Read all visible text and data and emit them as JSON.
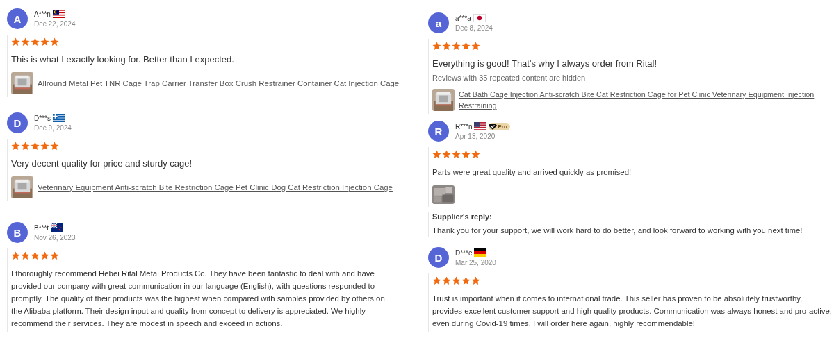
{
  "columns": [
    {
      "reviews": [
        {
          "initial": "A",
          "name": "A***n",
          "flag": {
            "kind": "my"
          },
          "date": "Dec 22, 2024",
          "stars": 5,
          "text": "This is what I exactly looking for. Better than I expected.",
          "product": {
            "kind": "picture",
            "title": "Allround Metal Pet TNR Cage Trap Carrier Transfer Box Crush Restrainer Container Cat Injection Cage"
          }
        },
        {
          "initial": "D",
          "name": "D***s",
          "flag": {
            "kind": "gr"
          },
          "date": "Dec 9, 2024",
          "stars": 5,
          "text": "Very decent quality for price and sturdy cage!",
          "product": {
            "kind": "picture",
            "title": "Veterinary Equipment Anti-scratch Bite Restriction Cage Pet Clinic Dog Cat Restriction Injection Cage"
          }
        },
        {
          "initial": "B",
          "name": "B***t",
          "flag": {
            "kind": "nz"
          },
          "date": "Nov 26, 2023",
          "stars": 5,
          "text": "I thoroughly recommend Hebei Rital Metal Products Co. They have been fantastic to deal with and have provided our company with great communication in our language (English), with questions responded to promptly. The quality of their products was the highest when compared with samples provided by others on the Alibaba platform. Their design input and quality from concept to delivery is appreciated. We highly recommend their services. They are modest in speech and exceed in actions."
        }
      ]
    },
    {
      "reviews": [
        {
          "initial": "a",
          "name": "a***a",
          "flag": {
            "kind": "jp"
          },
          "date": "Dec 8, 2024",
          "stars": 5,
          "text": "Everything is good! That's why I always order from Rital!",
          "note": "Reviews with 35 repeated content are hidden",
          "product": {
            "kind": "picture",
            "title": "Cat Bath Cage Injection Anti-scratch Bite Cat Restriction Cage for Pet Clinic Veterinary Equipment Injection Restraining"
          }
        },
        {
          "initial": "R",
          "name": "R***n",
          "flag": {
            "kind": "us"
          },
          "badge": "Pro",
          "date": "Apr 13, 2020",
          "stars": 5,
          "text": "Parts were great quality and arrived quickly as promised!",
          "reply": {
            "label": "Supplier's reply:",
            "text": "Thank you for your support, we will work hard to do better, and look forward to working with you next time!"
          }
        },
        {
          "initial": "D",
          "name": "D***e",
          "flag": {
            "kind": "de"
          },
          "date": "Mar 25, 2020",
          "stars": 5,
          "text": "Trust is important when it comes to international trade. This seller has proven to be absolutely trustworthy, provides excellent customer support and high quality products. Communication was always honest and pro-active, even during Covid-19 times. I will order here again, highly recommendable!"
        }
      ]
    }
  ]
}
